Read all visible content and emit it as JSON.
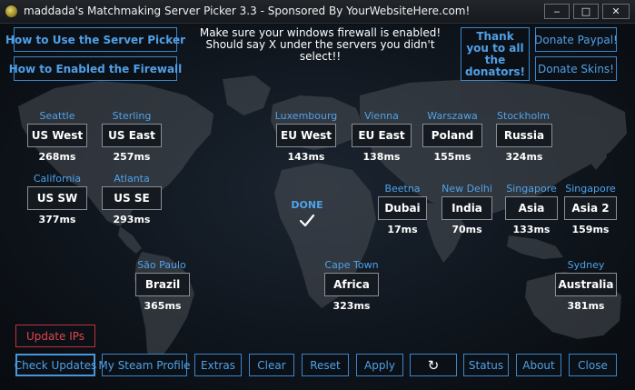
{
  "window": {
    "title": "maddada's Matchmaking Server Picker 3.3 - Sponsored By YourWebsiteHere.com!",
    "min_glyph": "‒",
    "max_glyph": "□",
    "close_glyph": "✕"
  },
  "top": {
    "how_to_use": "How to Use the Server Picker",
    "how_to_firewall": "How to Enabled the Firewall",
    "notice_line1": "Make sure your windows firewall is enabled!",
    "notice_line2": "Should say X under the servers you didn't select!!",
    "thank_you": "Thank you to all the donators!",
    "donate_paypal": "Donate Paypal!",
    "donate_skins": "Donate Skins!"
  },
  "servers": [
    {
      "city": "Seattle",
      "name": "US West",
      "ping": "268ms"
    },
    {
      "city": "Sterling",
      "name": "US East",
      "ping": "257ms"
    },
    {
      "city": "California",
      "name": "US SW",
      "ping": "377ms"
    },
    {
      "city": "Atlanta",
      "name": "US SE",
      "ping": "293ms"
    },
    {
      "city": "Luxembourg",
      "name": "EU West",
      "ping": "143ms"
    },
    {
      "city": "Vienna",
      "name": "EU East",
      "ping": "138ms"
    },
    {
      "city": "Warszawa",
      "name": "Poland",
      "ping": "155ms"
    },
    {
      "city": "Stockholm",
      "name": "Russia",
      "ping": "324ms"
    },
    {
      "city": "Beetna",
      "name": "Dubai",
      "ping": "17ms"
    },
    {
      "city": "New Delhi",
      "name": "India",
      "ping": "70ms"
    },
    {
      "city": "Singapore",
      "name": "Asia",
      "ping": "133ms"
    },
    {
      "city": "Singapore",
      "name": "Asia 2",
      "ping": "159ms"
    },
    {
      "city": "São Paulo",
      "name": "Brazil",
      "ping": "365ms"
    },
    {
      "city": "Cape Town",
      "name": "Africa",
      "ping": "323ms"
    },
    {
      "city": "Sydney",
      "name": "Australia",
      "ping": "381ms"
    }
  ],
  "done": {
    "label": "DONE"
  },
  "bottom": {
    "update_ips": "Update IPs",
    "check_updates": "Check Updates",
    "steam_profile": "My Steam Profile",
    "extras": "Extras",
    "clear": "Clear",
    "reset": "Reset",
    "apply": "Apply",
    "refresh_glyph": "↻",
    "status": "Status",
    "about": "About",
    "close": "Close"
  },
  "colors": {
    "accent": "#4fa0e8",
    "danger": "#e0454d",
    "background": "#0b0f14"
  }
}
